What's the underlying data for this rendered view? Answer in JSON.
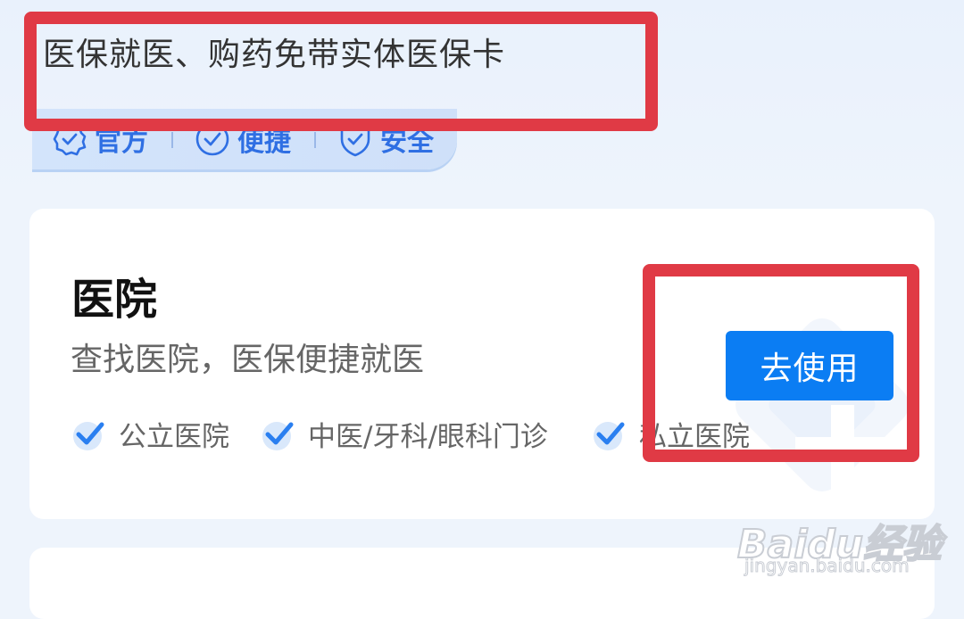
{
  "header": {
    "subtitle": "医保就医、购药免带实体医保卡",
    "features": [
      {
        "label": "官方",
        "icon": "badge-check-icon"
      },
      {
        "label": "便捷",
        "icon": "circle-check-icon"
      },
      {
        "label": "安全",
        "icon": "shield-check-icon"
      }
    ]
  },
  "hospital_card": {
    "title": "医院",
    "description": "查找医院，医保便捷就医",
    "button_label": "去使用",
    "tags": [
      {
        "label": "公立医院"
      },
      {
        "label": "中医/牙科/眼科门诊"
      },
      {
        "label": "私立医院"
      }
    ]
  },
  "watermark": {
    "brand": "Baidu经验",
    "url": "jingyan.baidu.com"
  },
  "colors": {
    "accent": "#0b7df3",
    "feature_blue": "#2f6fe3",
    "annotation_red": "#e03a45",
    "background": "#eef4fc"
  }
}
